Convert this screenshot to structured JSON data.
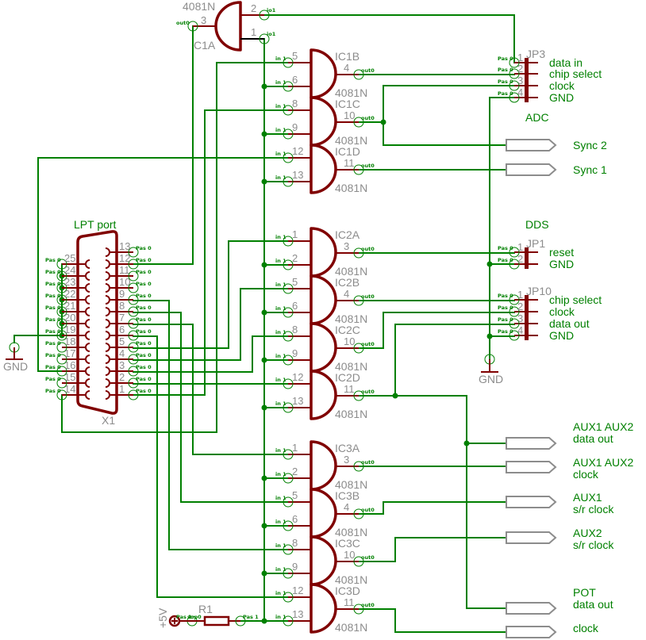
{
  "colors": {
    "wire": "#008000",
    "symbol": "#800000",
    "annotation": "#8c8c8c",
    "port": "#8c8c8c"
  },
  "pin_tags": {
    "input": "in 1",
    "output": "out0",
    "passive": "Pas 0",
    "io": "io1",
    "resistor_pin": "Pas 1",
    "supply_pin": "sup0"
  },
  "c1a": {
    "name": "C1A",
    "part": "4081N",
    "in_a": "2",
    "in_b": "1",
    "out": "3"
  },
  "gates": [
    {
      "name": "IC1B",
      "part": "4081N",
      "in_a": "5",
      "in_b": "6",
      "out": "4"
    },
    {
      "name": "IC1C",
      "part": "4081N",
      "in_a": "8",
      "in_b": "9",
      "out": "10"
    },
    {
      "name": "IC1D",
      "part": "4081N",
      "in_a": "12",
      "in_b": "13",
      "out": "11"
    },
    {
      "name": "IC2A",
      "part": "4081N",
      "in_a": "1",
      "in_b": "2",
      "out": "3"
    },
    {
      "name": "IC2B",
      "part": "4081N",
      "in_a": "5",
      "in_b": "6",
      "out": "4"
    },
    {
      "name": "IC2C",
      "part": "4081N",
      "in_a": "8",
      "in_b": "9",
      "out": "10"
    },
    {
      "name": "IC2D",
      "part": "4081N",
      "in_a": "12",
      "in_b": "13",
      "out": "11"
    },
    {
      "name": "IC3A",
      "part": "4081N",
      "in_a": "1",
      "in_b": "2",
      "out": "3"
    },
    {
      "name": "IC3B",
      "part": "4081N",
      "in_a": "5",
      "in_b": "6",
      "out": "4"
    },
    {
      "name": "IC3C",
      "part": "4081N",
      "in_a": "8",
      "in_b": "9",
      "out": "10"
    },
    {
      "name": "IC3D",
      "part": "4081N",
      "in_a": "12",
      "in_b": "13",
      "out": "11"
    }
  ],
  "lpt": {
    "title": "LPT port",
    "ref": "X1",
    "right_pins": [
      "13",
      "12",
      "11",
      "10",
      "9",
      "8",
      "7",
      "6",
      "5",
      "4",
      "3",
      "2",
      "1"
    ],
    "left_pins": [
      "25",
      "24",
      "23",
      "22",
      "21",
      "20",
      "19",
      "18",
      "17",
      "16",
      "15",
      "14"
    ]
  },
  "headers": [
    {
      "ref": "JP3",
      "group": "ADC",
      "pins": [
        "1",
        "2",
        "3",
        "4"
      ],
      "signals": [
        "data in",
        "chip select",
        "clock",
        "GND"
      ]
    },
    {
      "ref": "JP1",
      "group": "DDS",
      "pins": [
        "1",
        "2"
      ],
      "signals": [
        "reset",
        "GND"
      ]
    },
    {
      "ref": "JP10",
      "group": "",
      "pins": [
        "1",
        "2",
        "3",
        "4"
      ],
      "signals": [
        "chip select",
        "clock",
        "data out",
        "GND"
      ]
    }
  ],
  "ports": [
    {
      "lines": [
        "Sync 2"
      ]
    },
    {
      "lines": [
        "Sync 1"
      ]
    },
    {
      "lines": [
        "AUX1 AUX2",
        "data out"
      ]
    },
    {
      "lines": [
        "AUX1 AUX2",
        "clock"
      ]
    },
    {
      "lines": [
        "AUX1",
        "s/r clock"
      ]
    },
    {
      "lines": [
        "AUX2",
        "s/r clock"
      ]
    },
    {
      "lines": [
        "POT",
        "data out"
      ]
    },
    {
      "lines": [
        "clock"
      ]
    }
  ],
  "resistor": {
    "ref": "R1"
  },
  "supply": {
    "label": "+5V"
  },
  "grounds": [
    {
      "label": "GND"
    },
    {
      "label": "GND"
    }
  ]
}
